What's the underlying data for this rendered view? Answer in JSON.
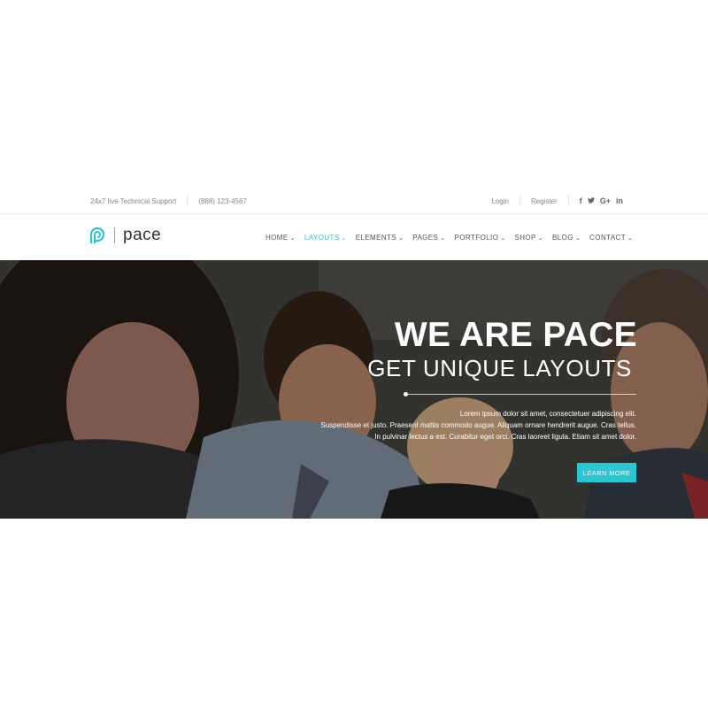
{
  "topbar": {
    "support_text": "24x7 live Technical Support",
    "phone": "(888) 123-4567",
    "login": "Login",
    "register": "Register",
    "social": {
      "facebook": "f",
      "twitter": "t",
      "googleplus": "G+",
      "linkedin": "in"
    }
  },
  "brand": {
    "name": "pace",
    "accent_color": "#2cc5d2"
  },
  "nav": {
    "items": [
      {
        "label": "HOME"
      },
      {
        "label": "LAYOUTS"
      },
      {
        "label": "ELEMENTS"
      },
      {
        "label": "PAGES"
      },
      {
        "label": "PORTFOLIO"
      },
      {
        "label": "SHOP"
      },
      {
        "label": "BLOG"
      },
      {
        "label": "CONTACT"
      }
    ],
    "active": "LAYOUTS"
  },
  "hero": {
    "title": "WE ARE PACE",
    "subtitle": "GET UNIQUE LAYOUTS",
    "text_line1": "Lorem ipsum dolor sit amet, consectetuer adipiscing elit.",
    "text_line2": "Suspendisse et justo. Praesent mattis commodo augue. Aliquam ornare hendrerit augue. Cras tellus.",
    "text_line3": "In pulvinar lectus a est. Curabitur eget orci. Cras laoreet ligula. Etiam sit amet dolor.",
    "button_label": "LEARN MORE"
  }
}
